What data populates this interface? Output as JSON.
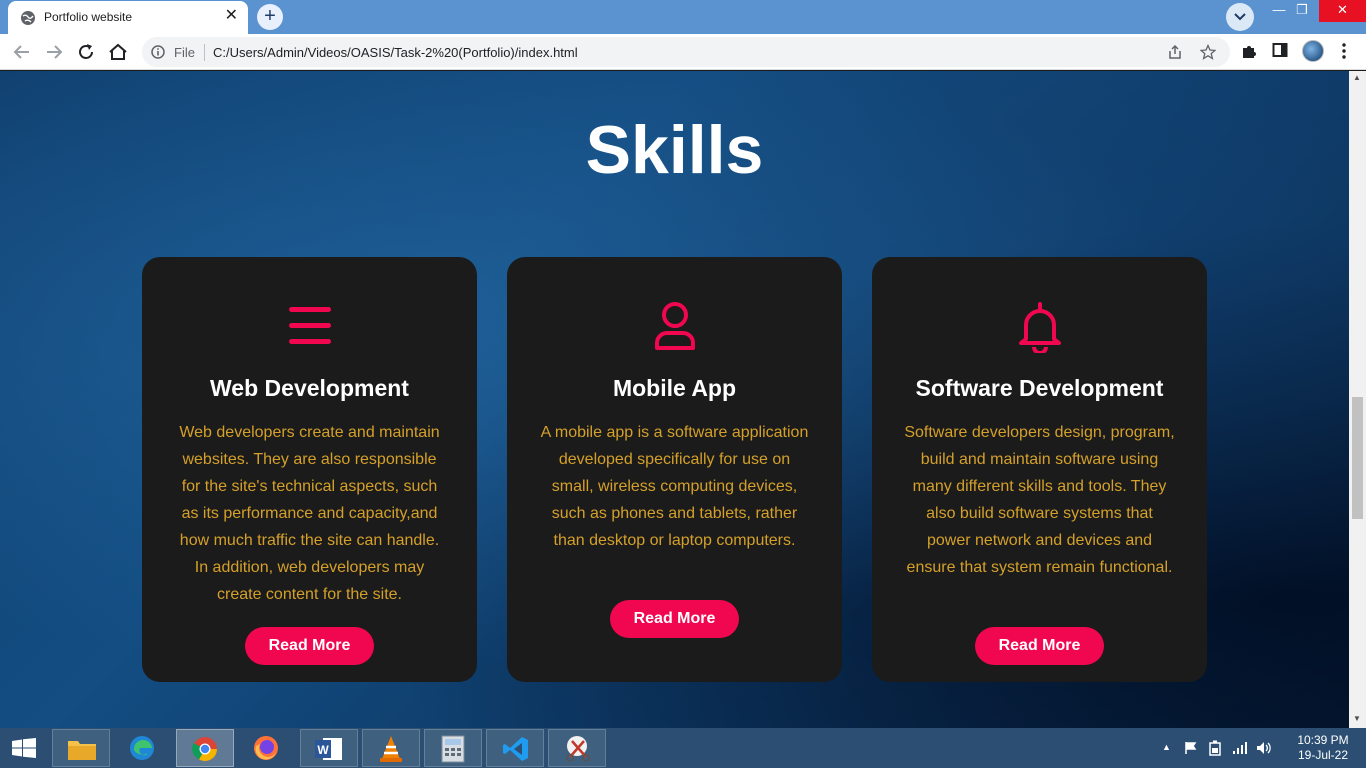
{
  "browser": {
    "tab_title": "Portfolio website",
    "tab_close": "✕",
    "new_tab": "+",
    "window_controls": {
      "minimize": "—",
      "maximize": "❐",
      "close": "✕"
    },
    "address_scheme": "File",
    "address_url": "C:/Users/Admin/Videos/OASIS/Task-2%20(Portfolio)/index.html"
  },
  "page": {
    "section_title": "Skills",
    "accent_color": "#f0074f",
    "text_color": "#d4a02a",
    "cards": [
      {
        "icon": "menu-icon",
        "title": "Web Development",
        "description": "Web developers create and maintain websites. They are also responsible for the site's technical aspects, such as its performance and capacity,and how much traffic the site can handle. In addition, web developers may create content for the site.",
        "button": "Read More"
      },
      {
        "icon": "user-icon",
        "title": "Mobile App",
        "description": "A mobile app is a software application developed specifically for use on small, wireless computing devices, such as phones and tablets, rather than desktop or laptop computers.",
        "button": "Read More"
      },
      {
        "icon": "bell-icon",
        "title": "Software Development",
        "description": "Software developers design, program, build and maintain software using many different skills and tools. They also build software systems that power network and devices and ensure that system remain functional.",
        "button": "Read More"
      }
    ]
  },
  "taskbar": {
    "apps": [
      "file-explorer",
      "edge",
      "chrome",
      "firefox",
      "word",
      "vlc",
      "calculator",
      "vscode",
      "snipping-tool"
    ],
    "clock_time": "10:39 PM",
    "clock_date": "19-Jul-22"
  }
}
